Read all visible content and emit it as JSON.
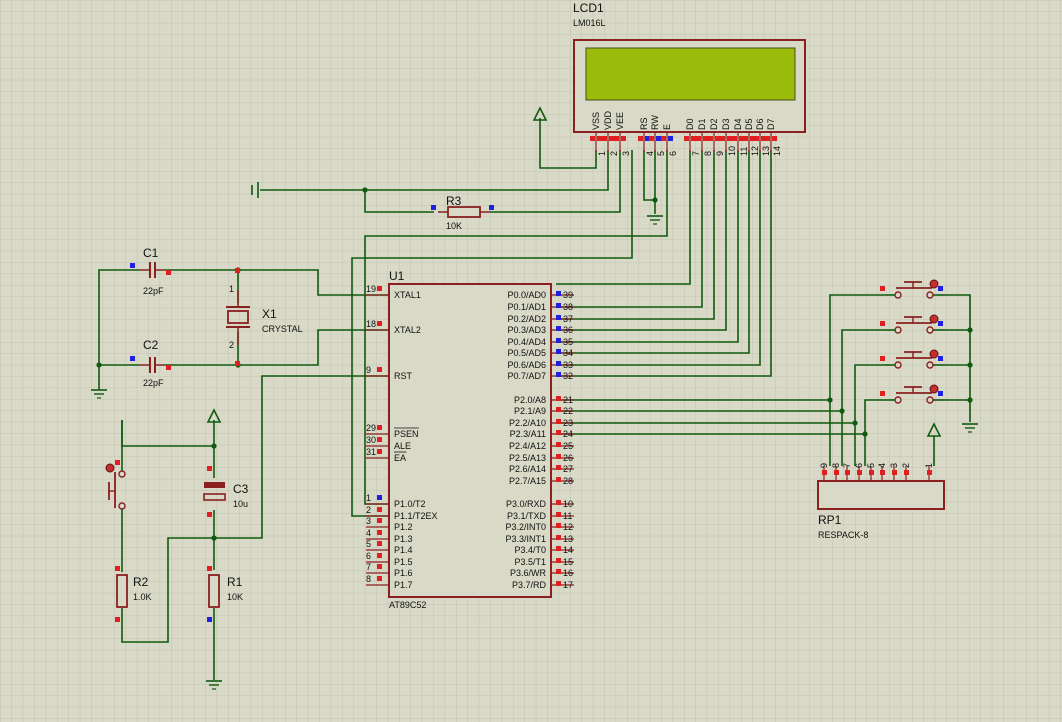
{
  "lcd": {
    "ref": "LCD1",
    "model": "LM016L",
    "pins": [
      {
        "name": "VSS",
        "num": "1"
      },
      {
        "name": "VDD",
        "num": "2"
      },
      {
        "name": "VEE",
        "num": "3"
      },
      {
        "name": "RS",
        "num": "4"
      },
      {
        "name": "RW",
        "num": "5"
      },
      {
        "name": "E",
        "num": "6"
      },
      {
        "name": "D0",
        "num": "7"
      },
      {
        "name": "D1",
        "num": "8"
      },
      {
        "name": "D2",
        "num": "9"
      },
      {
        "name": "D3",
        "num": "10"
      },
      {
        "name": "D4",
        "num": "11"
      },
      {
        "name": "D5",
        "num": "12"
      },
      {
        "name": "D6",
        "num": "13"
      },
      {
        "name": "D7",
        "num": "14"
      }
    ],
    "screen_color": "#9cbc0c"
  },
  "mcu": {
    "ref": "U1",
    "model": "AT89C52",
    "left_pins": [
      {
        "num": "19",
        "name": "XTAL1"
      },
      {
        "num": "18",
        "name": "XTAL2"
      },
      {
        "num": "9",
        "name": "RST"
      },
      {
        "num": "29",
        "name": "PSEN"
      },
      {
        "num": "30",
        "name": "ALE"
      },
      {
        "num": "31",
        "name": "EA"
      },
      {
        "num": "1",
        "name": "P1.0/T2"
      },
      {
        "num": "2",
        "name": "P1.1/T2EX"
      },
      {
        "num": "3",
        "name": "P1.2"
      },
      {
        "num": "4",
        "name": "P1.3"
      },
      {
        "num": "5",
        "name": "P1.4"
      },
      {
        "num": "6",
        "name": "P1.5"
      },
      {
        "num": "7",
        "name": "P1.6"
      },
      {
        "num": "8",
        "name": "P1.7"
      }
    ],
    "right_pins": [
      {
        "num": "39",
        "name": "P0.0/AD0"
      },
      {
        "num": "38",
        "name": "P0.1/AD1"
      },
      {
        "num": "37",
        "name": "P0.2/AD2"
      },
      {
        "num": "36",
        "name": "P0.3/AD3"
      },
      {
        "num": "35",
        "name": "P0.4/AD4"
      },
      {
        "num": "34",
        "name": "P0.5/AD5"
      },
      {
        "num": "33",
        "name": "P0.6/AD6"
      },
      {
        "num": "32",
        "name": "P0.7/AD7"
      },
      {
        "num": "21",
        "name": "P2.0/A8"
      },
      {
        "num": "22",
        "name": "P2.1/A9"
      },
      {
        "num": "23",
        "name": "P2.2/A10"
      },
      {
        "num": "24",
        "name": "P2.3/A11"
      },
      {
        "num": "25",
        "name": "P2.4/A12"
      },
      {
        "num": "26",
        "name": "P2.5/A13"
      },
      {
        "num": "27",
        "name": "P2.6/A14"
      },
      {
        "num": "28",
        "name": "P2.7/A15"
      },
      {
        "num": "10",
        "name": "P3.0/RXD"
      },
      {
        "num": "11",
        "name": "P3.1/TXD"
      },
      {
        "num": "12",
        "name": "P3.2/INT0"
      },
      {
        "num": "13",
        "name": "P3.3/INT1"
      },
      {
        "num": "14",
        "name": "P3.4/T0"
      },
      {
        "num": "15",
        "name": "P3.5/T1"
      },
      {
        "num": "16",
        "name": "P3.6/WR"
      },
      {
        "num": "17",
        "name": "P3.7/RD"
      }
    ]
  },
  "components": {
    "c1": {
      "ref": "C1",
      "value": "22pF"
    },
    "c2": {
      "ref": "C2",
      "value": "22pF"
    },
    "x1": {
      "ref": "X1",
      "value": "CRYSTAL",
      "pin1": "1",
      "pin2": "2"
    },
    "r3": {
      "ref": "R3",
      "value": "10K"
    },
    "c3": {
      "ref": "C3",
      "value": "10u"
    },
    "r1": {
      "ref": "R1",
      "value": "10K"
    },
    "r2": {
      "ref": "R2",
      "value": "1.0K"
    },
    "rp1": {
      "ref": "RP1",
      "value": "RESPACK-8",
      "pins": [
        "9",
        "8",
        "7",
        "6",
        "5",
        "4",
        "3",
        "2",
        "1"
      ]
    }
  },
  "colors": {
    "background": "#d9d9c8",
    "grid": "#c2c2b2",
    "wire": "#105a10",
    "component": "#8a2020",
    "pin_red": "#e02020",
    "pin_blue": "#2020e0"
  }
}
